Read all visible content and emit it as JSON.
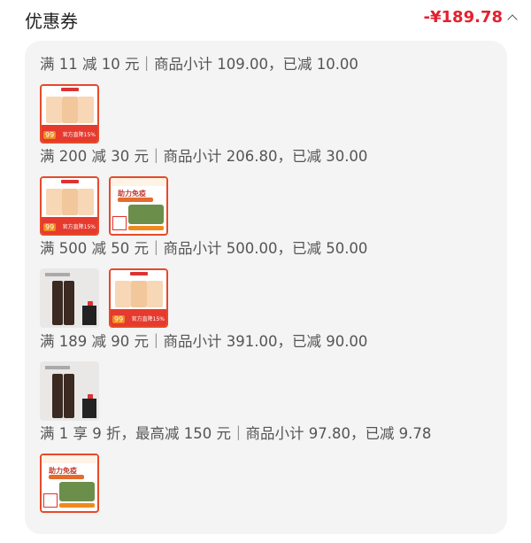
{
  "header": {
    "title": "优惠券",
    "total": "-¥189.78"
  },
  "groups": [
    {
      "summary": "满 11 减 10 元｜商品小计 109.00，已减 10.00",
      "thumbs": [
        "supplement-pack"
      ]
    },
    {
      "summary": "满 200 减 30 元｜商品小计 206.80，已减 30.00",
      "thumbs": [
        "supplement-pack",
        "immunity-box"
      ]
    },
    {
      "summary": "满 500 减 50 元｜商品小计 500.00，已减 50.00",
      "thumbs": [
        "pants",
        "supplement-pack"
      ]
    },
    {
      "summary": "满 189 减 90 元｜商品小计 391.00，已减 90.00",
      "thumbs": [
        "pants"
      ]
    },
    {
      "summary": "满 1 享 9 折，最高减 150 元｜商品小计 97.80，已减 9.78",
      "thumbs": [
        "immunity-box"
      ]
    }
  ],
  "product_text": {
    "supp_price": "99",
    "supp_tag": "官方直降15%",
    "box_headline": "助力免疫"
  },
  "colors": {
    "accent": "#e5202e",
    "panel": "#f4f4f4"
  }
}
